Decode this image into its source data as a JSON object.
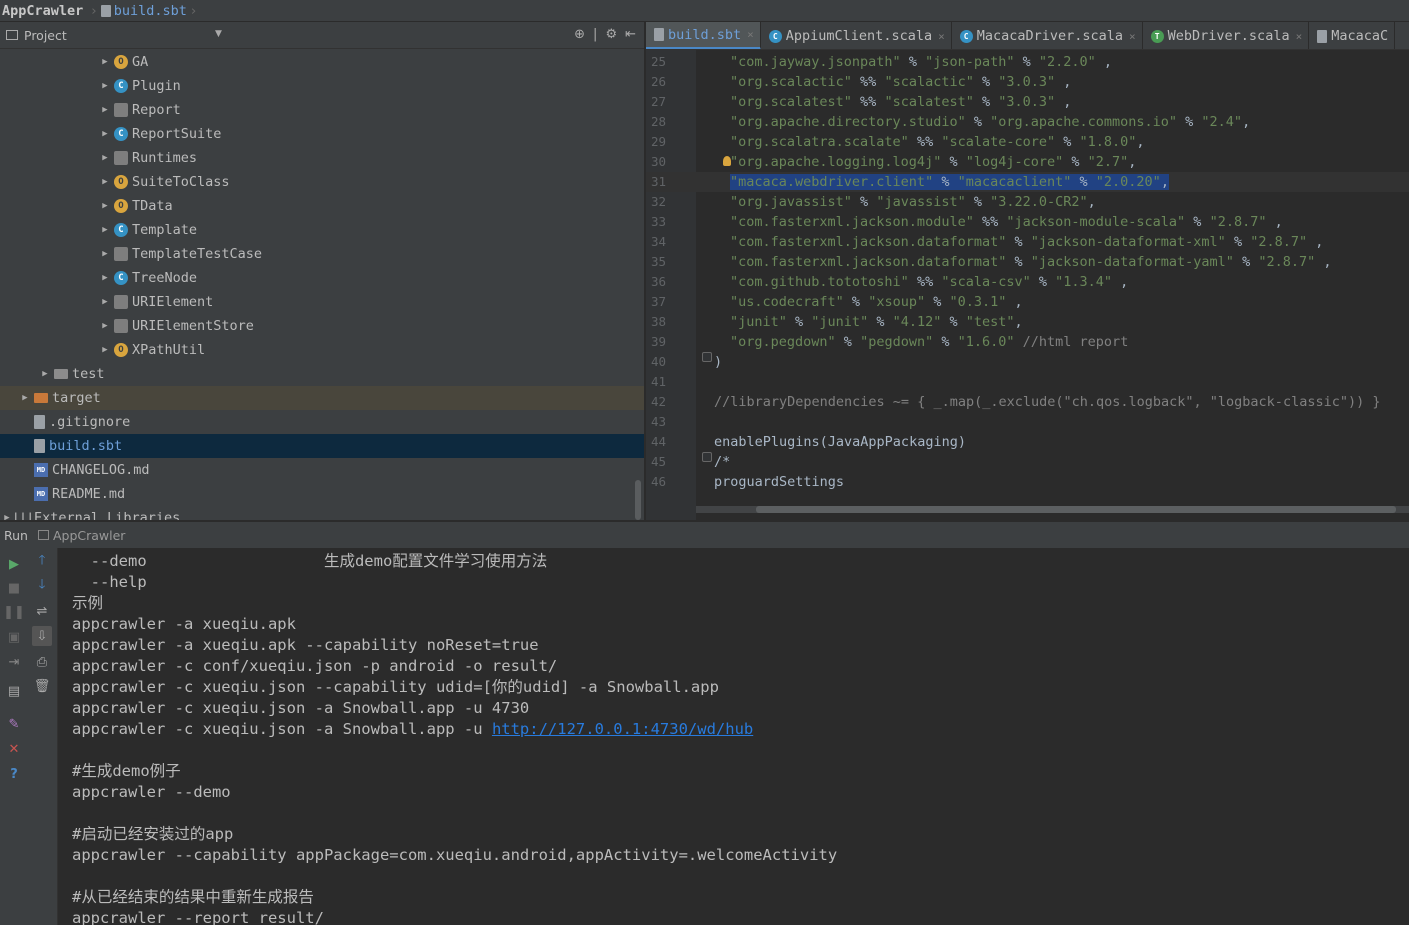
{
  "breadcrumb": {
    "app": "AppCrawler",
    "file": "build.sbt"
  },
  "project_panel": {
    "title": "Project",
    "tree": [
      {
        "label": "GA",
        "kind": "object",
        "indent": 3
      },
      {
        "label": "Plugin",
        "kind": "class",
        "indent": 3
      },
      {
        "label": "Report",
        "kind": "trait",
        "indent": 3
      },
      {
        "label": "ReportSuite",
        "kind": "class",
        "indent": 3
      },
      {
        "label": "Runtimes",
        "kind": "trait",
        "indent": 3
      },
      {
        "label": "SuiteToClass",
        "kind": "object",
        "indent": 3
      },
      {
        "label": "TData",
        "kind": "object",
        "indent": 3
      },
      {
        "label": "Template",
        "kind": "class",
        "indent": 3
      },
      {
        "label": "TemplateTestCase",
        "kind": "trait",
        "indent": 3
      },
      {
        "label": "TreeNode",
        "kind": "class",
        "indent": 3
      },
      {
        "label": "URIElement",
        "kind": "trait",
        "indent": 3
      },
      {
        "label": "URIElementStore",
        "kind": "trait",
        "indent": 3
      },
      {
        "label": "XPathUtil",
        "kind": "object",
        "indent": 3
      },
      {
        "label": "test",
        "kind": "folder",
        "indent": 1
      },
      {
        "label": "target",
        "kind": "folder-orange",
        "indent": 0
      },
      {
        "label": ".gitignore",
        "kind": "file",
        "indent": 0
      },
      {
        "label": "build.sbt",
        "kind": "sbt",
        "indent": 0,
        "selected": true
      },
      {
        "label": "CHANGELOG.md",
        "kind": "md",
        "indent": 0
      },
      {
        "label": "README.md",
        "kind": "md",
        "indent": 0
      },
      {
        "label": "External Libraries",
        "kind": "lib",
        "indent": -1
      }
    ]
  },
  "editor": {
    "tabs": [
      {
        "label": "build.sbt",
        "active": true,
        "icon": "sbt-file-icon",
        "color": "#9aa0a6"
      },
      {
        "label": "AppiumClient.scala",
        "active": false,
        "icon": "scala-class-icon",
        "color": "#3592c4"
      },
      {
        "label": "MacacaDriver.scala",
        "active": false,
        "icon": "scala-class-icon",
        "color": "#3592c4"
      },
      {
        "label": "WebDriver.scala",
        "active": false,
        "icon": "scala-trait-icon",
        "color": "#499c54"
      },
      {
        "label": "MacacaC",
        "active": false,
        "icon": "sbt-file-icon",
        "color": "#9aa0a6"
      }
    ],
    "lines": [
      {
        "n": "25",
        "code": "\"com.jayway.jsonpath\" % \"json-path\" % \"2.2.0\" ,"
      },
      {
        "n": "26",
        "code": "\"org.scalactic\" %% \"scalactic\" % \"3.0.3\" ,"
      },
      {
        "n": "27",
        "code": "\"org.scalatest\" %% \"scalatest\" % \"3.0.3\" ,"
      },
      {
        "n": "28",
        "code": "\"org.apache.directory.studio\" % \"org.apache.commons.io\" % \"2.4\","
      },
      {
        "n": "29",
        "code": "\"org.scalatra.scalate\" %% \"scalate-core\" % \"1.8.0\","
      },
      {
        "n": "30",
        "code": "\"org.apache.logging.log4j\" % \"log4j-core\" % \"2.7\","
      },
      {
        "n": "31",
        "code": "\"macaca.webdriver.client\" % \"macacaclient\" % \"2.0.20\","
      },
      {
        "n": "32",
        "code": "\"org.javassist\" % \"javassist\" % \"3.22.0-CR2\","
      },
      {
        "n": "33",
        "code": "\"com.fasterxml.jackson.module\" %% \"jackson-module-scala\" % \"2.8.7\" ,"
      },
      {
        "n": "34",
        "code": "\"com.fasterxml.jackson.dataformat\" % \"jackson-dataformat-xml\" % \"2.8.7\" ,"
      },
      {
        "n": "35",
        "code": "\"com.fasterxml.jackson.dataformat\" % \"jackson-dataformat-yaml\" % \"2.8.7\" ,"
      },
      {
        "n": "36",
        "code": "\"com.github.tototoshi\" %% \"scala-csv\" % \"1.3.4\" ,"
      },
      {
        "n": "37",
        "code": "\"us.codecraft\" % \"xsoup\" % \"0.3.1\" ,"
      },
      {
        "n": "38",
        "code": "\"junit\" % \"junit\" % \"4.12\" % \"test\","
      },
      {
        "n": "39",
        "code": "\"org.pegdown\" % \"pegdown\" % \"1.6.0\" //html report"
      },
      {
        "n": "40",
        "code": ")"
      },
      {
        "n": "41",
        "code": ""
      },
      {
        "n": "42",
        "code": "//libraryDependencies ~= { _.map(_.exclude(\"ch.qos.logback\", \"logback-classic\")) }"
      },
      {
        "n": "43",
        "code": ""
      },
      {
        "n": "44",
        "code": "enablePlugins(JavaAppPackaging)"
      },
      {
        "n": "45",
        "code": "/*"
      },
      {
        "n": "46",
        "code": "proguardSettings"
      }
    ]
  },
  "run_panel": {
    "label": "Run",
    "config": "AppCrawler",
    "console": [
      "  --demo                   生成demo配置文件学习使用方法",
      "  --help",
      "示例",
      "appcrawler -a xueqiu.apk",
      "appcrawler -a xueqiu.apk --capability noReset=true",
      "appcrawler -c conf/xueqiu.json -p android -o result/",
      "appcrawler -c xueqiu.json --capability udid=[你的udid] -a Snowball.app",
      "appcrawler -c xueqiu.json -a Snowball.app -u 4730",
      "appcrawler -c xueqiu.json -a Snowball.app -u ",
      "",
      "#生成demo例子",
      "appcrawler --demo",
      "",
      "#启动已经安装过的app",
      "appcrawler --capability appPackage=com.xueqiu.android,appActivity=.welcomeActivity",
      "",
      "#从已经结束的结果中重新生成报告",
      "appcrawler --report result/"
    ],
    "link": "http://127.0.0.1:4730/wd/hub"
  },
  "colors": {
    "accent": "#4a88c7",
    "string": "#6a8759",
    "link": "#287bde",
    "selection": "#214283"
  }
}
